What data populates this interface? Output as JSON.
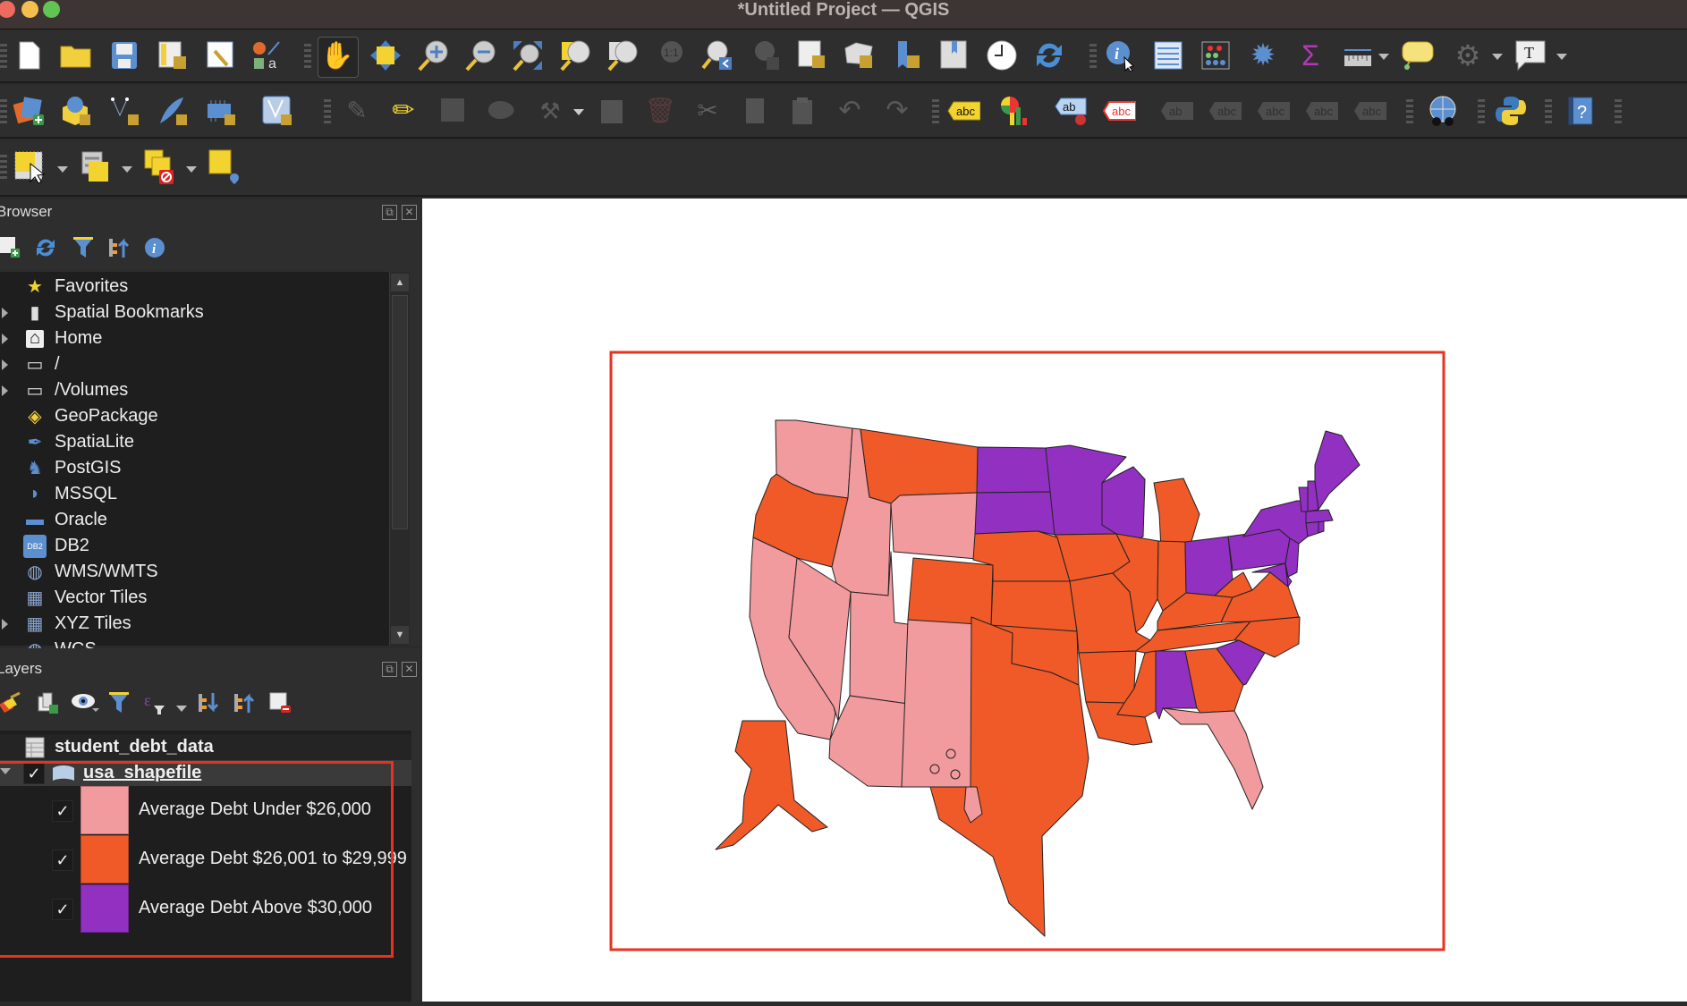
{
  "window": {
    "title": "*Untitled Project — QGIS"
  },
  "toolbars": {
    "project": [
      "new-project-icon",
      "open-project-icon",
      "save-project-icon",
      "new-print-layout-icon",
      "layout-manager-icon",
      "style-manager-icon"
    ],
    "navigation": [
      "pan-map-icon",
      "pan-to-selection-icon",
      "zoom-in-icon",
      "zoom-out-icon",
      "zoom-full-icon",
      "zoom-to-selection-icon",
      "zoom-to-layer-icon",
      "zoom-native-icon",
      "zoom-last-icon",
      "zoom-next-icon",
      "new-map-view-icon",
      "new-3d-map-view-icon",
      "new-bookmark-icon",
      "show-bookmarks-icon",
      "temporal-controller-icon",
      "refresh-icon"
    ],
    "attributes": [
      "identify-features-icon",
      "open-attribute-table-icon",
      "statistical-summary-icon",
      "processing-toolbox-icon",
      "field-calculator-icon",
      "measure-line-icon",
      "map-tips-icon",
      "run-feature-action-icon",
      "text-annotation-icon"
    ],
    "data_source": [
      "data-source-manager-icon",
      "new-geopackage-layer-icon",
      "new-shapefile-layer-icon",
      "new-spatialite-layer-icon",
      "new-temporary-layer-icon",
      "new-virtual-layer-icon"
    ],
    "digitizing": [
      "current-edits-icon",
      "toggle-editing-icon",
      "save-edits-icon",
      "digitize-polygon-icon",
      "vertex-tool-icon",
      "modify-attributes-icon",
      "delete-selected-icon",
      "cut-features-icon",
      "copy-features-icon",
      "paste-features-icon",
      "undo-icon",
      "redo-icon"
    ],
    "labels": [
      "label-toolbar-icon",
      "diagram-options-icon",
      "highlight-pinned-labels-icon",
      "pin-labels-icon",
      "show-hide-labels-icon",
      "move-label-icon",
      "rotate-label-icon",
      "change-label-icon",
      "layer-labeling-icon"
    ],
    "plugins": [
      "metasearch-icon",
      "python-console-icon",
      "help-icon"
    ],
    "selection": [
      "select-features-icon",
      "select-by-value-icon",
      "deselect-all-icon",
      "select-by-location-icon"
    ]
  },
  "browser": {
    "title": "Browser",
    "items": [
      {
        "label": "Favorites",
        "icon": "star-icon",
        "expandable": false
      },
      {
        "label": "Spatial Bookmarks",
        "icon": "bookmark-icon",
        "expandable": true
      },
      {
        "label": "Home",
        "icon": "home-icon",
        "expandable": true
      },
      {
        "label": "/",
        "icon": "folder-icon",
        "expandable": true
      },
      {
        "label": "/Volumes",
        "icon": "folder-icon",
        "expandable": true
      },
      {
        "label": "GeoPackage",
        "icon": "geopackage-icon",
        "expandable": false
      },
      {
        "label": "SpatiaLite",
        "icon": "feather-icon",
        "expandable": false
      },
      {
        "label": "PostGIS",
        "icon": "elephant-icon",
        "expandable": false
      },
      {
        "label": "MSSQL",
        "icon": "mssql-icon",
        "expandable": false
      },
      {
        "label": "Oracle",
        "icon": "oracle-icon",
        "expandable": false
      },
      {
        "label": "DB2",
        "icon": "db2-icon",
        "expandable": false
      },
      {
        "label": "WMS/WMTS",
        "icon": "globe-icon",
        "expandable": false
      },
      {
        "label": "Vector Tiles",
        "icon": "grid-icon",
        "expandable": false
      },
      {
        "label": "XYZ Tiles",
        "icon": "grid-icon",
        "expandable": true
      },
      {
        "label": "WCS",
        "icon": "globe-icon",
        "expandable": false
      }
    ],
    "db2_badge": "DB2"
  },
  "layers": {
    "title": "Layers",
    "items": [
      {
        "name": "student_debt_data",
        "type": "table"
      },
      {
        "name": "usa_shapefile",
        "type": "polygon",
        "checked": true,
        "expanded": true
      }
    ],
    "legend": [
      {
        "label": "Average Debt Under $26,000",
        "color": "#f29b9e",
        "checked": true
      },
      {
        "label": "Average Debt $26,001 to $29,999",
        "color": "#ef5a28",
        "checked": true
      },
      {
        "label": "Average Debt Above $30,000",
        "color": "#9130c1",
        "checked": true
      }
    ],
    "check_glyph": "✓"
  },
  "map": {
    "highlight_color": "#e8321f",
    "stroke_color": "#222222",
    "categories": {
      "low": "#f29b9e",
      "mid": "#ef5a28",
      "high": "#9130c1"
    },
    "states": {
      "WA": "low",
      "OR": "mid",
      "CA": "low",
      "ID": "low",
      "NV": "low",
      "UT": "low",
      "AZ": "low",
      "MT": "mid",
      "WY": "low",
      "CO": "mid",
      "NM": "low",
      "ND": "high",
      "SD": "high",
      "NE": "mid",
      "KS": "mid",
      "OK": "mid",
      "TX": "mid",
      "MN": "high",
      "IA": "mid",
      "MO": "mid",
      "AR": "mid",
      "LA": "mid",
      "WI": "high",
      "IL": "mid",
      "MI": "mid",
      "IN": "mid",
      "OH": "high",
      "KY": "mid",
      "TN": "mid",
      "MS": "mid",
      "AL": "high",
      "GA": "mid",
      "FL": "low",
      "SC": "high",
      "NC": "mid",
      "VA": "mid",
      "WV": "mid",
      "PA": "high",
      "NY": "high",
      "NJ": "high",
      "DE": "high",
      "MD": "high",
      "CT": "high",
      "RI": "high",
      "MA": "high",
      "VT": "high",
      "NH": "high",
      "ME": "high",
      "AK": "mid",
      "HI": "low"
    }
  }
}
